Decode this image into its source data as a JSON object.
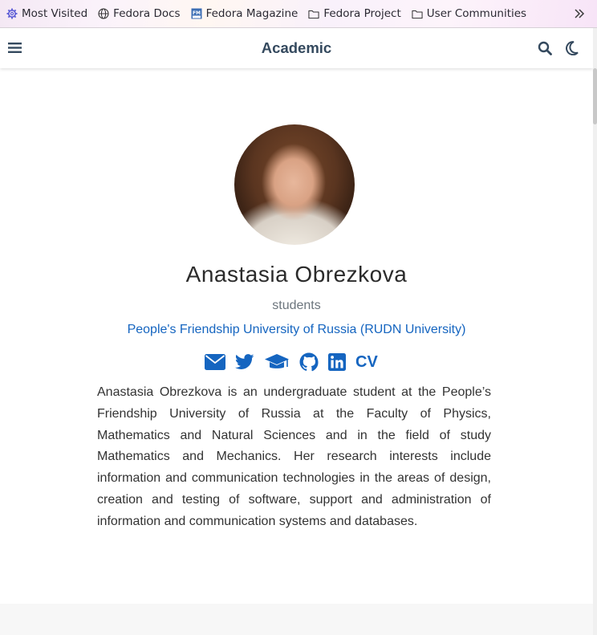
{
  "bookmarks": {
    "items": [
      {
        "label": "Most Visited",
        "icon": "gear-icon"
      },
      {
        "label": "Fedora Docs",
        "icon": "globe-icon"
      },
      {
        "label": "Fedora Magazine",
        "icon": "fedora-magazine-icon"
      },
      {
        "label": "Fedora Project",
        "icon": "folder-icon"
      },
      {
        "label": "User Communities",
        "icon": "folder-icon"
      }
    ],
    "overflow_icon": "chevron-double-right-icon"
  },
  "navbar": {
    "title": "Academic",
    "menu_icon": "hamburger-icon",
    "search_icon": "search-icon",
    "theme_icon": "moon-icon"
  },
  "profile": {
    "name": "Anastasia Obrezkova",
    "role": "students",
    "organization": "People's Friendship University of Russia (RUDN University)",
    "social": [
      {
        "icon": "envelope-icon"
      },
      {
        "icon": "twitter-icon"
      },
      {
        "icon": "graduation-cap-icon"
      },
      {
        "icon": "github-icon"
      },
      {
        "icon": "linkedin-icon"
      },
      {
        "icon": "cv-icon",
        "label": "CV"
      }
    ],
    "bio": "Anastasia Obrezkova is an undergraduate student at the People’s Friendship University of Russia at the Faculty of Physics, Mathematics and Natural Sciences and in the field of study Mathematics and Mechanics. Her research interests include information and communication technologies in the areas of design, creation and testing of software, support and administration of information and communication systems and databases."
  },
  "colors": {
    "accent": "#1565c0",
    "title": "#34495e",
    "text": "#333333"
  }
}
